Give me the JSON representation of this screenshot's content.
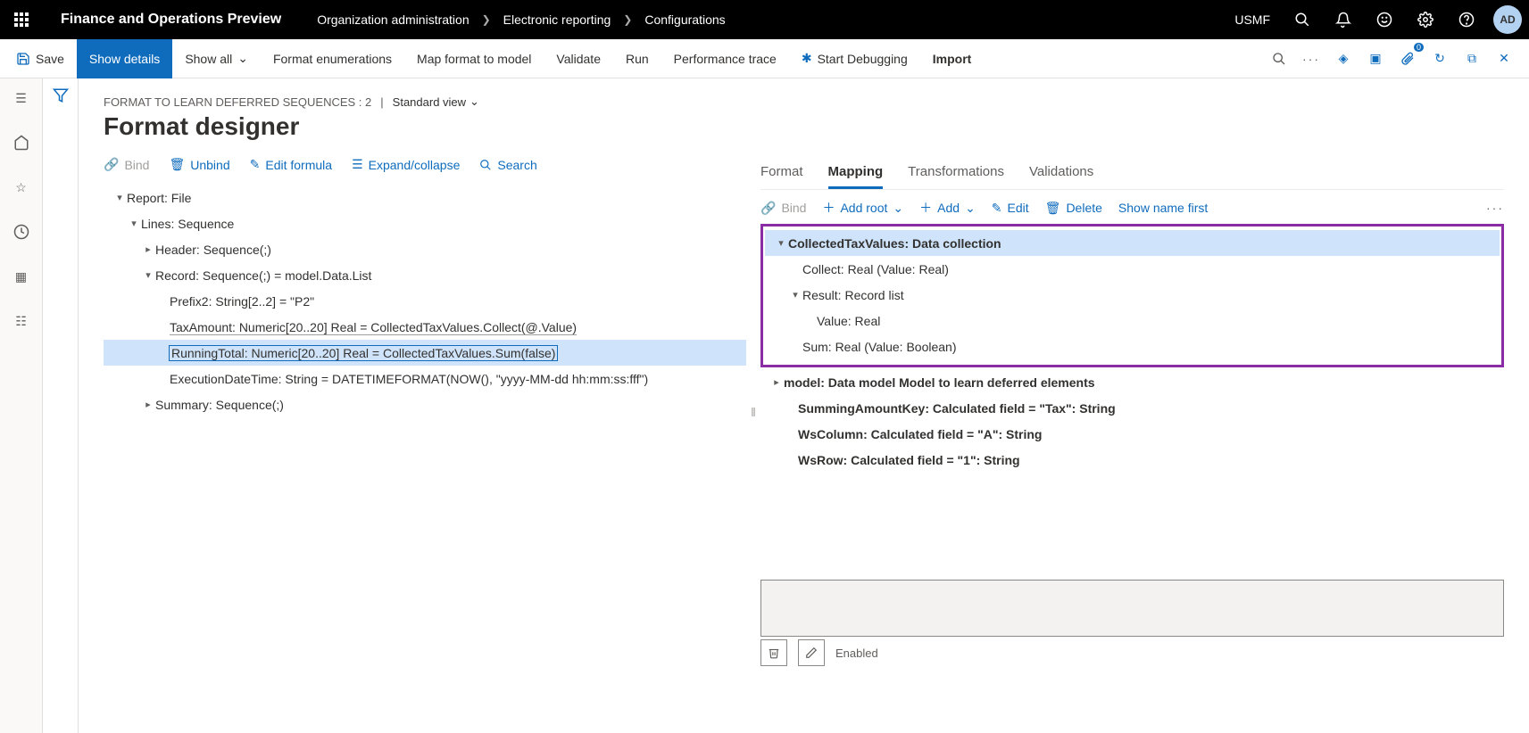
{
  "header": {
    "app_title": "Finance and Operations Preview",
    "breadcrumb": [
      "Organization administration",
      "Electronic reporting",
      "Configurations"
    ],
    "company": "USMF",
    "avatar": "AD"
  },
  "cmdbar": {
    "save": "Save",
    "show_details": "Show details",
    "show_all": "Show all",
    "format_enum": "Format enumerations",
    "map_format": "Map format to model",
    "validate": "Validate",
    "run": "Run",
    "perf_trace": "Performance trace",
    "start_debug": "Start Debugging",
    "import": "Import"
  },
  "page": {
    "meta_left": "FORMAT TO LEARN DEFERRED SEQUENCES : 2",
    "std_view": "Standard view",
    "title": "Format designer"
  },
  "actions": {
    "bind": "Bind",
    "unbind": "Unbind",
    "edit_formula": "Edit formula",
    "expand_collapse": "Expand/collapse",
    "search": "Search"
  },
  "format_tree": {
    "n0": "Report: File",
    "n1": "Lines: Sequence",
    "n2": "Header: Sequence(;)",
    "n3": "Record: Sequence(;) = model.Data.List",
    "n4": "Prefix2: String[2..2] = \"P2\"",
    "n5": "TaxAmount: Numeric[20..20] Real = CollectedTaxValues.Collect(@.Value)",
    "n6": "RunningTotal: Numeric[20..20] Real = CollectedTaxValues.Sum(false)",
    "n7": "ExecutionDateTime: String = DATETIMEFORMAT(NOW(), \"yyyy-MM-dd hh:mm:ss:fff\")",
    "n8": "Summary: Sequence(;)"
  },
  "tabs": {
    "format": "Format",
    "mapping": "Mapping",
    "transformations": "Transformations",
    "validations": "Validations"
  },
  "map_actions": {
    "bind": "Bind",
    "add_root": "Add root",
    "add": "Add",
    "edit": "Edit",
    "delete": "Delete",
    "show_name_first": "Show name first"
  },
  "map_tree": {
    "m0": "CollectedTaxValues: Data collection",
    "m1": "Collect: Real (Value: Real)",
    "m2": "Result: Record list",
    "m3": "Value: Real",
    "m4": "Sum: Real (Value: Boolean)",
    "m5": "model: Data model Model to learn deferred elements",
    "m6": "SummingAmountKey: Calculated field = \"Tax\": String",
    "m7": "WsColumn: Calculated field = \"A\": String",
    "m8": "WsRow: Calculated field = \"1\": String"
  },
  "bottom": {
    "enabled": "Enabled"
  }
}
